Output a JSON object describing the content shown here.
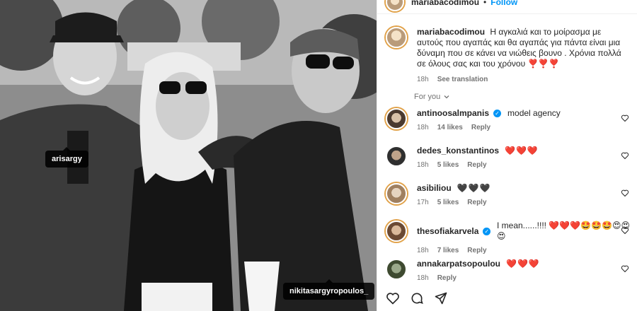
{
  "post": {
    "tags": [
      "arisargy",
      "nikitasargyropoulos_"
    ]
  },
  "header": {
    "username": "mariabacodimou",
    "dot": "•",
    "follow_label": "Follow"
  },
  "caption": {
    "username": "mariabacodimou",
    "text": "Η αγκαλιά και το μοίρασμα με αυτούς που αγαπάς και θα αγαπάς για πάντα είναι μια δύναμη που σε κάνει να νιώθεις βουνο . Χρόνια πολλά σε όλους σας και του χρόνου ❣️❣️❣️",
    "time": "18h",
    "see_translation": "See translation"
  },
  "for_you_label": "For you",
  "comments": [
    {
      "username": "antinoosalmpanis",
      "verified": true,
      "text": "model agency",
      "time": "18h",
      "likes": "14 likes",
      "reply": "Reply"
    },
    {
      "username": "dedes_konstantinos",
      "verified": false,
      "text": "❤️❤️❤️",
      "time": "18h",
      "likes": "5 likes",
      "reply": "Reply"
    },
    {
      "username": "asibiliou",
      "verified": false,
      "text": "🖤🖤🖤",
      "time": "17h",
      "likes": "5 likes",
      "reply": "Reply"
    },
    {
      "username": "thesofiakarvela",
      "verified": true,
      "text": "I mean......!!!! ❤️❤️❤️🤩🤩🤩😍😍😍",
      "time": "18h",
      "likes": "7 likes",
      "reply": "Reply"
    },
    {
      "username": "annakarpatsopoulou",
      "verified": false,
      "text": "❤️❤️❤️",
      "time": "18h",
      "likes": "",
      "reply": "Reply"
    }
  ],
  "colors": {
    "accent": "#0095f6",
    "muted": "#737373",
    "text": "#262626",
    "heart": "#d21a2b"
  },
  "icons": [
    "like-heart-icon",
    "comment-icon",
    "share-icon",
    "chevron-down-icon",
    "verified-badge-icon"
  ]
}
